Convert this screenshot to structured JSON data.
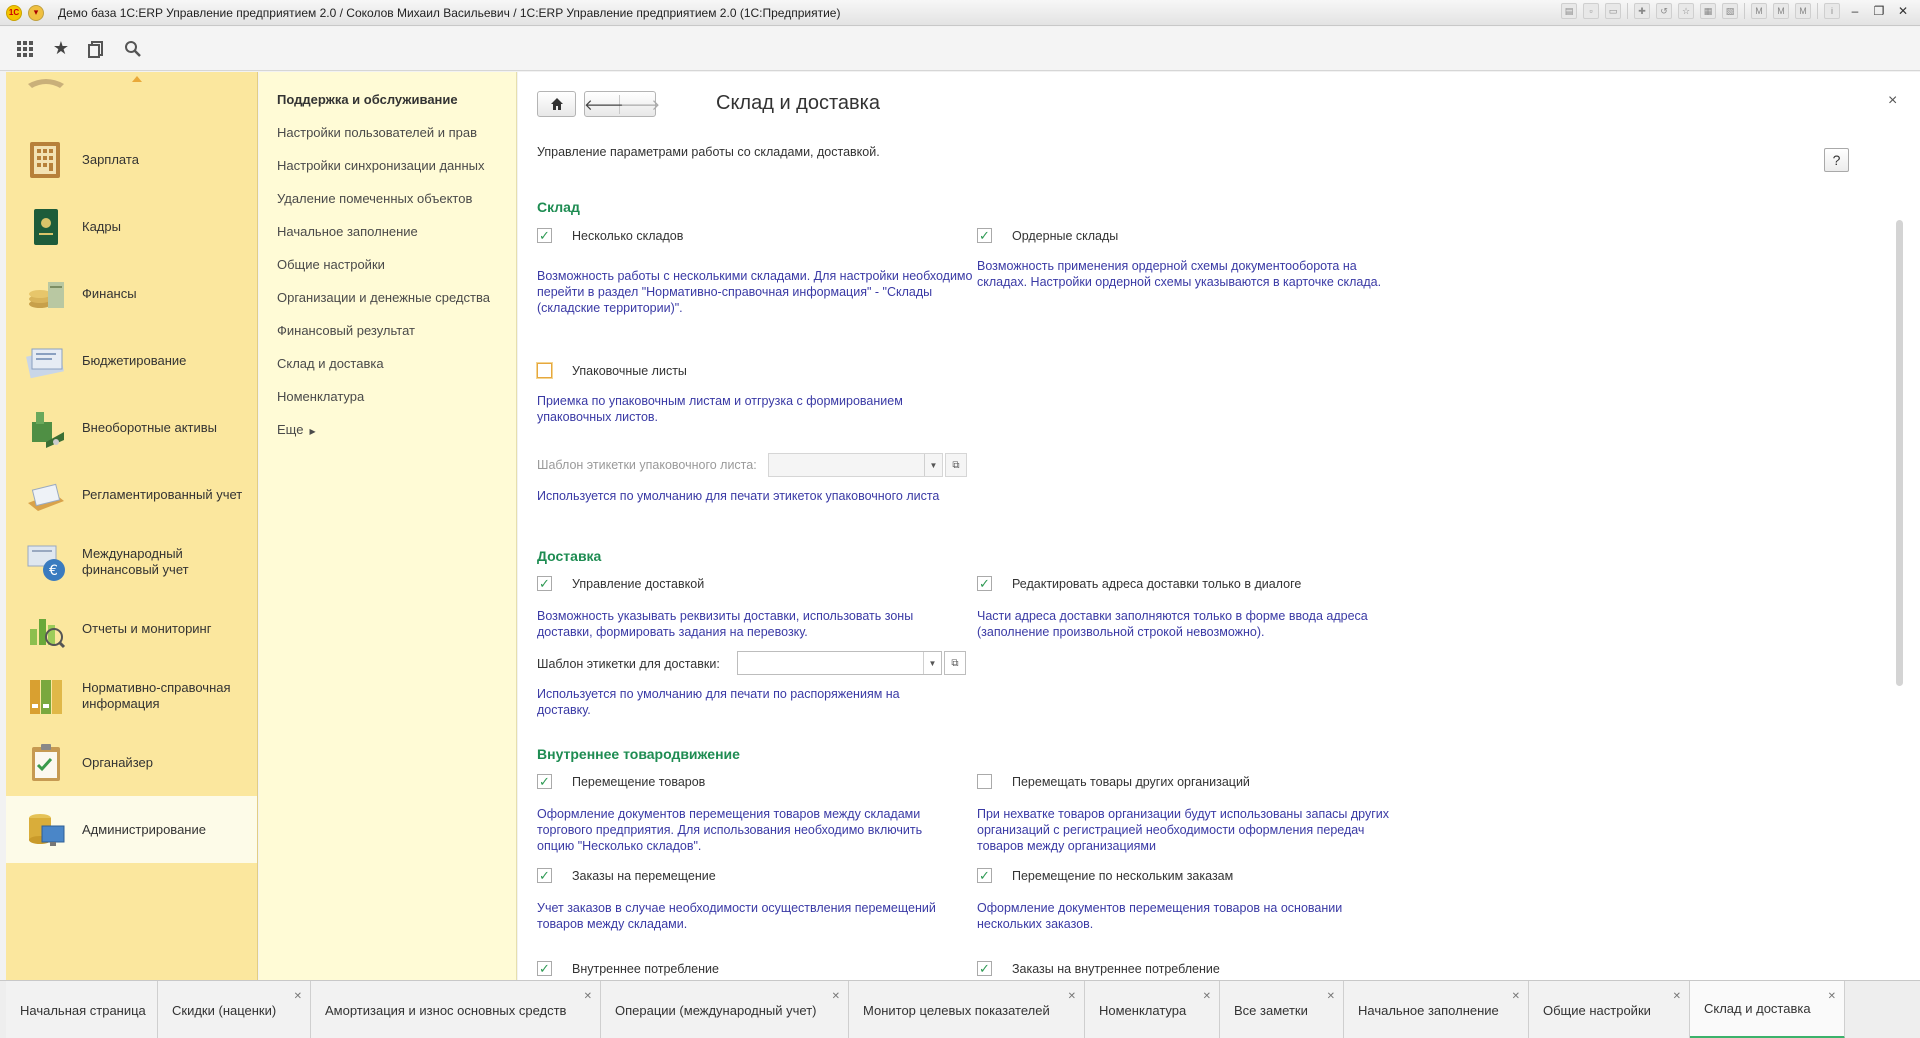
{
  "window": {
    "title": "Демо база 1С:ERP Управление предприятием 2.0 / Соколов Михаил Васильевич / 1С:ERP Управление предприятием 2.0  (1С:Предприятие)",
    "logo_text": "1С"
  },
  "toolbar": {
    "icons": [
      "apps-grid-icon",
      "star-icon",
      "history-icon",
      "search-icon"
    ]
  },
  "sections": [
    {
      "label": "Зарплата",
      "icon": "salary-icon"
    },
    {
      "label": "Кадры",
      "icon": "hr-icon"
    },
    {
      "label": "Финансы",
      "icon": "finance-icon"
    },
    {
      "label": "Бюджетирование",
      "icon": "budget-icon"
    },
    {
      "label": "Внеоборотные активы",
      "icon": "assets-icon"
    },
    {
      "label": "Регламентированный учет",
      "icon": "accounting-icon"
    },
    {
      "label": "Международный финансовый учет",
      "icon": "intl-accounting-icon"
    },
    {
      "label": "Отчеты и мониторинг",
      "icon": "reports-icon"
    },
    {
      "label": "Нормативно-справочная информация",
      "icon": "reference-icon"
    },
    {
      "label": "Органайзер",
      "icon": "organizer-icon"
    },
    {
      "label": "Администрирование",
      "icon": "admin-icon",
      "active": true
    }
  ],
  "commands": {
    "header": "Поддержка и обслуживание",
    "items": [
      "Настройки пользователей и прав",
      "Настройки синхронизации данных",
      "Удаление помеченных объектов",
      "Начальное заполнение",
      "Общие настройки",
      "Организации и денежные средства",
      "Финансовый результат",
      "Склад и доставка",
      "Номенклатура"
    ],
    "more": "Еще"
  },
  "form": {
    "title": "Склад и доставка",
    "intro": "Управление параметрами работы со складами, доставкой.",
    "help": "?",
    "close": "×",
    "warehouse": {
      "title": "Склад",
      "multiple": {
        "label": "Несколько складов",
        "checked": true,
        "note": "Возможность работы с несколькими складами. Для настройки необходимо перейти в раздел \"Нормативно-справочная информация\" - \"Склады (складские территории)\"."
      },
      "order": {
        "label": "Ордерные склады",
        "checked": true,
        "note": "Возможность применения ордерной схемы документооборота на складах. Настройки ордерной схемы указываются в карточке склада."
      },
      "packing": {
        "label": "Упаковочные листы",
        "checked": false,
        "note": "Приемка по упаковочным листам и отгрузка с формированием упаковочных листов."
      },
      "packing_template": {
        "label": "Шаблон этикетки упаковочного листа:",
        "value": "",
        "note": "Используется по умолчанию для печати этикеток упаковочного листа"
      }
    },
    "delivery": {
      "title": "Доставка",
      "manage": {
        "label": "Управление доставкой",
        "checked": true,
        "note": "Возможность указывать реквизиты доставки, использовать зоны доставки, формировать задания на перевозку."
      },
      "edit_address": {
        "label": "Редактировать адреса доставки только в диалоге",
        "checked": true,
        "note": "Части адреса доставки заполняются только в форме ввода адреса (заполнение произвольной строкой невозможно)."
      },
      "template": {
        "label": "Шаблон этикетки для доставки:",
        "value": "",
        "note": "Используется по умолчанию для печати по распоряжениям на доставку."
      }
    },
    "internal": {
      "title": "Внутреннее товародвижение",
      "transfer": {
        "label": "Перемещение товаров",
        "checked": true,
        "note": "Оформление документов перемещения товаров между складами торгового предприятия. Для использования необходимо включить опцию \"Несколько складов\"."
      },
      "other_orgs": {
        "label": "Перемещать товары других организаций",
        "checked": false,
        "note": "При нехватке товаров организации будут использованы запасы других организаций с регистрацией необходимости оформления передач товаров между организациями"
      },
      "transfer_orders": {
        "label": "Заказы на перемещение",
        "checked": true,
        "note": "Учет заказов в случае необходимости осуществления перемещений товаров между складами."
      },
      "multi_orders": {
        "label": "Перемещение по нескольким заказам",
        "checked": true,
        "note": "Оформление документов перемещения товаров на основании нескольких заказов."
      },
      "consumption": {
        "label": "Внутреннее потребление",
        "checked": true
      },
      "consumption_orders": {
        "label": "Заказы на внутреннее потребление",
        "checked": true
      }
    }
  },
  "tabs": [
    {
      "label": "Начальная страница",
      "closable": false
    },
    {
      "label": "Скидки (наценки)",
      "closable": true
    },
    {
      "label": "Амортизация и износ основных средств",
      "closable": true
    },
    {
      "label": "Операции (международный учет)",
      "closable": true
    },
    {
      "label": "Монитор целевых показателей",
      "closable": true
    },
    {
      "label": "Номенклатура",
      "closable": true
    },
    {
      "label": "Все заметки",
      "closable": true
    },
    {
      "label": "Начальное заполнение",
      "closable": true
    },
    {
      "label": "Общие настройки",
      "closable": true
    },
    {
      "label": "Склад и доставка",
      "closable": true,
      "active": true
    }
  ],
  "colors": {
    "sections_bg": "#fbe79e",
    "commands_bg": "#fffbd6",
    "group_title": "#1e8c52",
    "note_text": "#3a3aa5",
    "active_tab_accent": "#3bb26b"
  }
}
